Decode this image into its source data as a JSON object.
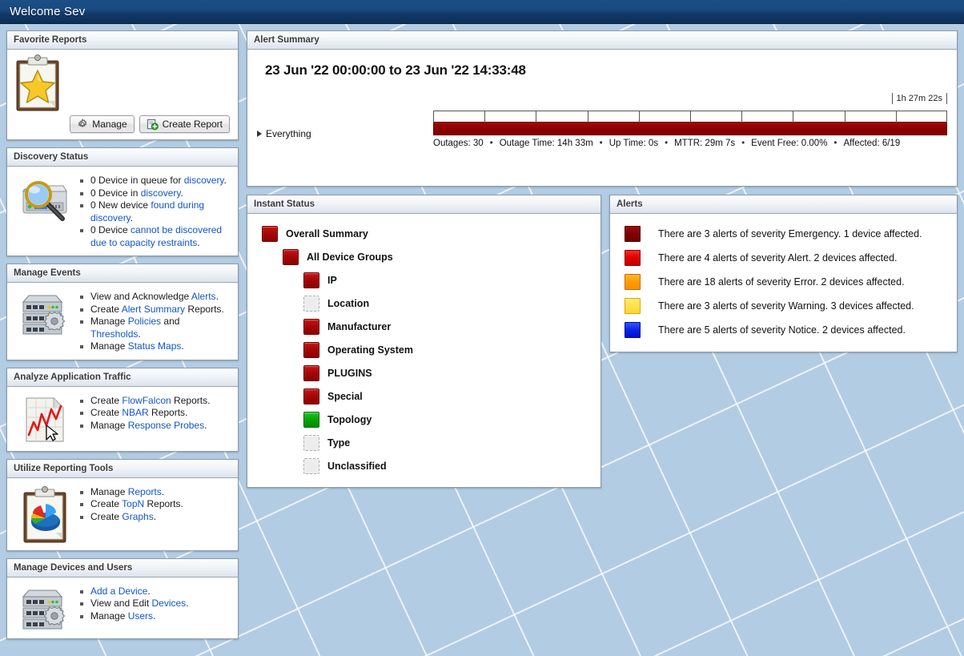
{
  "app": {
    "title": "Welcome Sev",
    "background_color": "#b2cce4",
    "header_color": "#123a68"
  },
  "favorite_reports": {
    "heading": "Favorite Reports",
    "manage_label": "Manage",
    "create_label": "Create Report"
  },
  "discovery_status": {
    "heading": "Discovery Status",
    "items": [
      {
        "pre": "0 Device in queue for ",
        "link": "discovery",
        "post": "."
      },
      {
        "pre": "0 Device in ",
        "link": "discovery",
        "post": "."
      },
      {
        "pre": "0 New device ",
        "link": "found during discovery",
        "post": "."
      },
      {
        "pre": "0 Device ",
        "link": "cannot be discovered due to capacity restraints",
        "post": "."
      }
    ]
  },
  "manage_events": {
    "heading": "Manage Events",
    "items": [
      {
        "pre": "View and Acknowledge ",
        "link": "Alerts",
        "post": "."
      },
      {
        "pre": "Create ",
        "link": "Alert Summary",
        "post": " Reports."
      },
      {
        "pre": "Manage ",
        "link": "Policies",
        "mid": " and ",
        "link2": "Thresholds",
        "post": "."
      },
      {
        "pre": "Manage ",
        "link": "Status Maps",
        "post": "."
      }
    ]
  },
  "analyze_traffic": {
    "heading": "Analyze Application Traffic",
    "items": [
      {
        "pre": "Create ",
        "link": "FlowFalcon",
        "post": " Reports."
      },
      {
        "pre": "Create ",
        "link": "NBAR",
        "post": " Reports."
      },
      {
        "pre": "Manage ",
        "link": "Response Probes",
        "post": "."
      }
    ]
  },
  "reporting_tools": {
    "heading": "Utilize Reporting Tools",
    "items": [
      {
        "pre": "Manage ",
        "link": "Reports",
        "post": "."
      },
      {
        "pre": "Create ",
        "link": "TopN",
        "post": " Reports."
      },
      {
        "pre": "Create ",
        "link": "Graphs",
        "post": "."
      }
    ]
  },
  "devices_users": {
    "heading": "Manage Devices and Users",
    "items": [
      {
        "pre": "",
        "link": "Add a Device",
        "post": "."
      },
      {
        "pre": "View and Edit ",
        "link": "Devices",
        "post": "."
      },
      {
        "pre": "Manage ",
        "link": "Users",
        "post": "."
      }
    ]
  },
  "alert_summary": {
    "heading": "Alert Summary",
    "date_range": "23 Jun '22 00:00:00 to 23 Jun '22 14:33:48",
    "duration_label": "1h 27m 22s",
    "row_label": "Everything",
    "bar_color": "#8f0000",
    "bar_fill_percent": 100,
    "tick_count": 11,
    "stats": [
      "Outages: 30",
      "Outage Time: 14h 33m",
      "Up Time: 0s",
      "MTTR: 29m 7s",
      "Event Free: 0.00%",
      "Affected: 6/19"
    ]
  },
  "instant_status": {
    "heading": "Instant Status",
    "tree": [
      {
        "label": "Overall Summary",
        "status": "red",
        "depth": 0
      },
      {
        "label": "All Device Groups",
        "status": "red",
        "depth": 1
      },
      {
        "label": "IP",
        "status": "red",
        "depth": 2
      },
      {
        "label": "Location",
        "status": "empty",
        "depth": 2
      },
      {
        "label": "Manufacturer",
        "status": "red",
        "depth": 2
      },
      {
        "label": "Operating System",
        "status": "red",
        "depth": 2
      },
      {
        "label": "PLUGINS",
        "status": "red",
        "depth": 2
      },
      {
        "label": "Special",
        "status": "red",
        "depth": 2
      },
      {
        "label": "Topology",
        "status": "green",
        "depth": 2
      },
      {
        "label": "Type",
        "status": "empty",
        "depth": 2
      },
      {
        "label": "Unclassified",
        "status": "empty",
        "depth": 2
      }
    ]
  },
  "alerts": {
    "heading": "Alerts",
    "rows": [
      {
        "severity": "emergency",
        "color": "#7d0000",
        "text": "There are 3 alerts of severity Emergency. 1 device affected."
      },
      {
        "severity": "alert",
        "color": "#e00000",
        "text": "There are 4 alerts of severity Alert. 2 devices affected."
      },
      {
        "severity": "error",
        "color": "#ff9c00",
        "text": "There are 18 alerts of severity Error. 2 devices affected."
      },
      {
        "severity": "warning",
        "color": "#ffe04d",
        "text": "There are 3 alerts of severity Warning. 3 devices affected."
      },
      {
        "severity": "notice",
        "color": "#0a22e8",
        "text": "There are 5 alerts of severity Notice. 2 devices affected."
      }
    ]
  }
}
